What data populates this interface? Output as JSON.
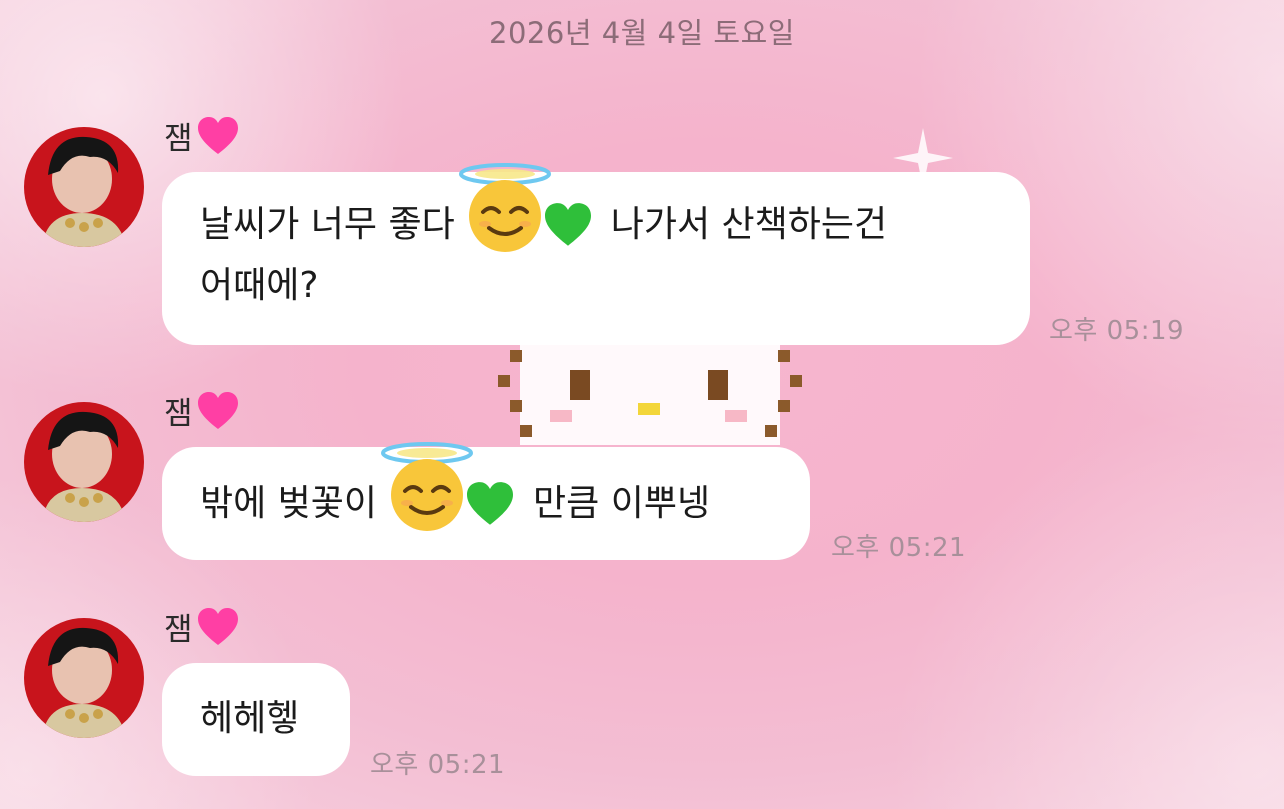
{
  "date_header": "2026년 4월 4일 토요일",
  "messages": [
    {
      "sender": "잼",
      "part1": "날씨가 너무 좋다",
      "part2": "나가서 산책하는건",
      "part3": "어때에?",
      "time": "오후 05:19"
    },
    {
      "sender": "잼",
      "part1": "밖에 벚꽃이",
      "part2": "만큼 이뿌넹",
      "time": "오후 05:21"
    },
    {
      "sender": "잼",
      "part1": "헤헤헿",
      "time": "오후 05:21"
    }
  ],
  "icons": {
    "sender_heart": "pink-heart-icon",
    "halo_emoji": "smiling-face-with-halo-icon",
    "green_heart": "green-heart-icon"
  },
  "colors": {
    "background": "#f5b3cc",
    "bubble": "#ffffff",
    "timestamp": "#a8909a",
    "date": "#8c6c78",
    "heart_pink": "#ff3fa4",
    "heart_green": "#2fbf3a"
  }
}
